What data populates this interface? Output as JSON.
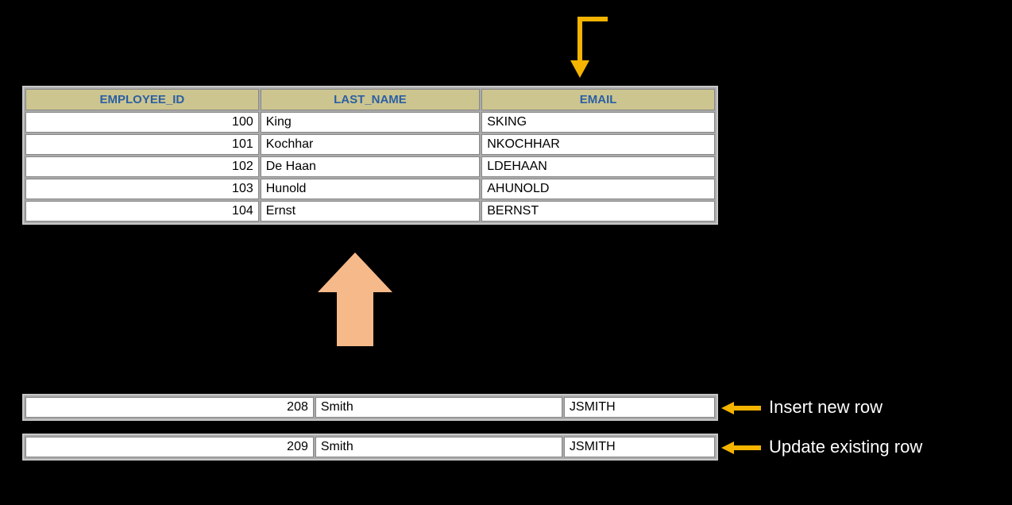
{
  "table": {
    "columns": [
      "EMPLOYEE_ID",
      "LAST_NAME",
      "EMAIL"
    ],
    "rows": [
      {
        "id": "100",
        "last_name": "King",
        "email": "SKING"
      },
      {
        "id": "101",
        "last_name": "Kochhar",
        "email": "NKOCHHAR"
      },
      {
        "id": "102",
        "last_name": "De Haan",
        "email": "LDEHAAN"
      },
      {
        "id": "103",
        "last_name": "Hunold",
        "email": "AHUNOLD"
      },
      {
        "id": "104",
        "last_name": "Ernst",
        "email": "BERNST"
      }
    ]
  },
  "insert_row": {
    "id": "208",
    "last_name": "Smith",
    "email": "JSMITH"
  },
  "update_row": {
    "id": "209",
    "last_name": "Smith",
    "email": "JSMITH"
  },
  "labels": {
    "insert": "Insert new row",
    "update": "Update existing row"
  },
  "colors": {
    "header_bg": "#ccc58f",
    "header_fg": "#2b5fa3",
    "arrow_yellow": "#f4b400",
    "arrow_peach": "#f6b98a"
  }
}
